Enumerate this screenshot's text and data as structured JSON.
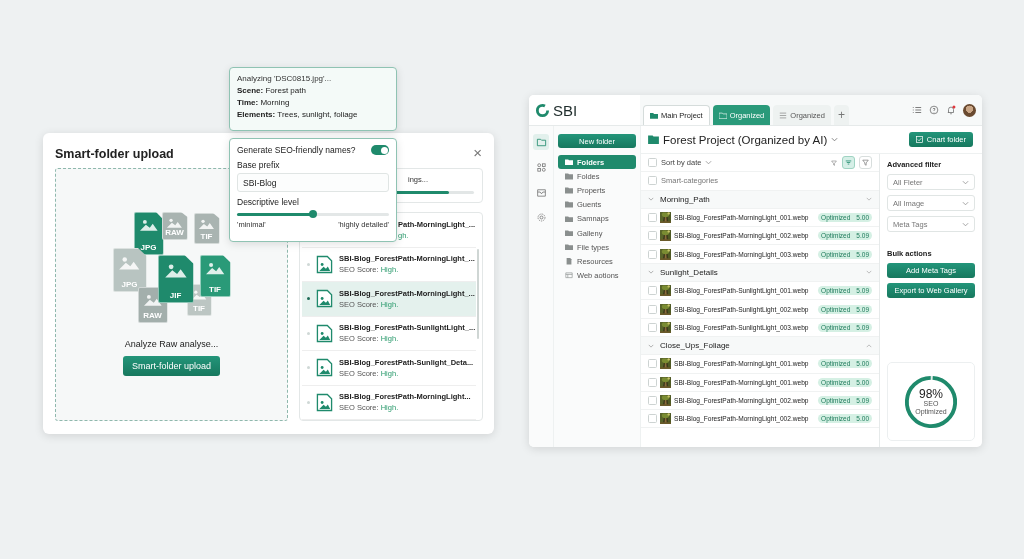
{
  "analysis_popover": {
    "title": "Analyzing 'DSC0815.jpg'...",
    "lines": [
      "**Scene:** Forest path",
      "**Time:** Morning",
      "**Elements:** Trees, sunlight, foliage"
    ]
  },
  "naming_popover": {
    "toggle_label": "Generate SEO-friendly names?",
    "toggle_on": true,
    "prefix_label": "Base prefix",
    "prefix_value": "SBI-Blog",
    "level_label": "Descriptive level",
    "level": 0.5,
    "min_label": "'minimal'",
    "max_label": "'highly detailed'"
  },
  "upload_dialog": {
    "title": "Smart-folder upload",
    "close": "×",
    "tiles": [
      {
        "label": "JPG",
        "color": "#1f8a6c"
      },
      {
        "label": "RAW",
        "color": "#a9b4b1"
      },
      {
        "label": "TIF",
        "color": "#a9b4b1"
      },
      {
        "label": "JPG",
        "color": "#b8c4c1"
      },
      {
        "label": "RAW",
        "color": "#a3afac"
      },
      {
        "label": "TIF",
        "color": "#bcc6c3"
      },
      {
        "label": "JIF",
        "color": "#1f8a6c"
      },
      {
        "label": "TIF",
        "color": "#2a9a78"
      }
    ],
    "status": "Analyze Raw analyse...",
    "button": "Smart-folder upload",
    "progress": {
      "text": "ings...",
      "level": 0.85
    },
    "files": [
      {
        "kind": "cut",
        "name": "Path-MorningLight_...",
        "score": "gh.",
        "selected": false
      },
      {
        "kind": "file",
        "name": "SBI-Blog_ForestPath-MorningLight_...",
        "score_label": "SEO Score:",
        "score": "High.",
        "selected": false
      },
      {
        "kind": "file",
        "name": "SBI-Blog_ForestPath-MorningLight_...",
        "score_label": "SEO Score:",
        "score": "High.",
        "selected": true
      },
      {
        "kind": "file",
        "name": "SBI-Blog_ForestPath-SunlightLight_...",
        "score_label": "SEO Score:",
        "score": "High.",
        "selected": false
      },
      {
        "kind": "file",
        "name": "SBI-Blog_ForestPath-Sunlight_Deta...",
        "score_label": "SEO Score:",
        "score": "High.",
        "selected": false
      },
      {
        "kind": "file",
        "name": "SBI-Blog_ForestPath-MorningLight...",
        "score_label": "SEO Score:",
        "score": "High.",
        "selected": false
      }
    ]
  },
  "app": {
    "logo": "SBI",
    "tabs": [
      {
        "label": "Main Project",
        "kind": "folder",
        "selected": true,
        "accent": false
      },
      {
        "label": "Organized",
        "kind": "folder",
        "selected": false,
        "accent": true
      },
      {
        "label": "Organized",
        "kind": "list",
        "selected": false,
        "accent": false
      }
    ],
    "add_tab": "+",
    "notification": true,
    "rail": [
      {
        "kind": "folder",
        "selected": true
      },
      {
        "kind": "grid",
        "selected": false
      },
      {
        "kind": "box",
        "selected": false
      },
      {
        "kind": "gear",
        "selected": false
      }
    ],
    "new_folder": "New folder",
    "nav": [
      {
        "label": "Folders",
        "kind": "folder",
        "selected": true
      },
      {
        "label": "Foldes",
        "kind": "folder",
        "selected": false
      },
      {
        "label": "Properts",
        "kind": "folder",
        "selected": false
      },
      {
        "label": "Guents",
        "kind": "folder",
        "selected": false
      },
      {
        "label": "Samnaps",
        "kind": "folder",
        "selected": false
      },
      {
        "label": "Galleny",
        "kind": "folder",
        "selected": false
      },
      {
        "label": "File types",
        "kind": "folder",
        "selected": false
      },
      {
        "label": "Resources",
        "kind": "doc",
        "selected": false
      },
      {
        "label": "Web aotions",
        "kind": "web",
        "selected": false
      }
    ],
    "title": "Forest Project (Organized by AI)",
    "smart_button": "Cnart folder",
    "sort": "Sort by date",
    "sort_checked": false,
    "smart_categories": "Smart-categories",
    "smart_checked": false,
    "groups": [
      {
        "name": "Morning_Path",
        "expanded": true,
        "chevron_up": false,
        "files": [
          {
            "name": "SBI-Blog_ForestPath-MorningLight_001.webp",
            "status": "Optimized",
            "score": "5.00",
            "checked": false
          },
          {
            "name": "SBI-Blog_ForestPath-MorningLight_002.webp",
            "status": "Optimized",
            "score": "5.09",
            "checked": false
          },
          {
            "name": "SBI-Blog_ForestPath-MorningLight_003.webp",
            "status": "Optimized",
            "score": "5.09",
            "checked": false
          }
        ]
      },
      {
        "name": "Sunlight_Details",
        "expanded": true,
        "chevron_up": false,
        "files": [
          {
            "name": "SBI-Blog_ForestPath-SunlightLight_001.webp",
            "status": "Optimized",
            "score": "5.09",
            "checked": false
          },
          {
            "name": "SBI-Blog_ForestPath-SunlightLight_002.webp",
            "status": "Optimized",
            "score": "5.09",
            "checked": false
          },
          {
            "name": "SBI-Blog_ForestPath-SunlightLight_003.webp",
            "status": "Optimized",
            "score": "5.09",
            "checked": false
          }
        ]
      },
      {
        "name": "Close_Ups_Foliage",
        "expanded": true,
        "chevron_up": true,
        "files": [
          {
            "name": "SBI-Blog_ForestPath-MorningLight_001.webp",
            "status": "Optimized",
            "score": "5.00",
            "checked": false
          },
          {
            "name": "SBI-Blog_ForestPath-MorningLight_001.webp",
            "status": "Optimized",
            "score": "5.00",
            "checked": false
          },
          {
            "name": "SBI-Blog_ForestPath-MorningLight_002.webp",
            "status": "Optimized",
            "score": "5.09",
            "checked": false
          },
          {
            "name": "SBI-Blog_ForestPath-MorningLight_002.webp",
            "status": "Optimized",
            "score": "5.00",
            "checked": false
          }
        ]
      }
    ],
    "filter_title": "Advanced filter",
    "selects": [
      "All Fleter",
      "All Image",
      "Meta Tags"
    ],
    "bulk_title": "Bulk actions",
    "actions": [
      "Add Meta Tags",
      "Export to Web Gallery"
    ],
    "score": {
      "value": "98%",
      "label_lines": [
        "SEO",
        "Optimized"
      ],
      "level": 0.98
    }
  }
}
